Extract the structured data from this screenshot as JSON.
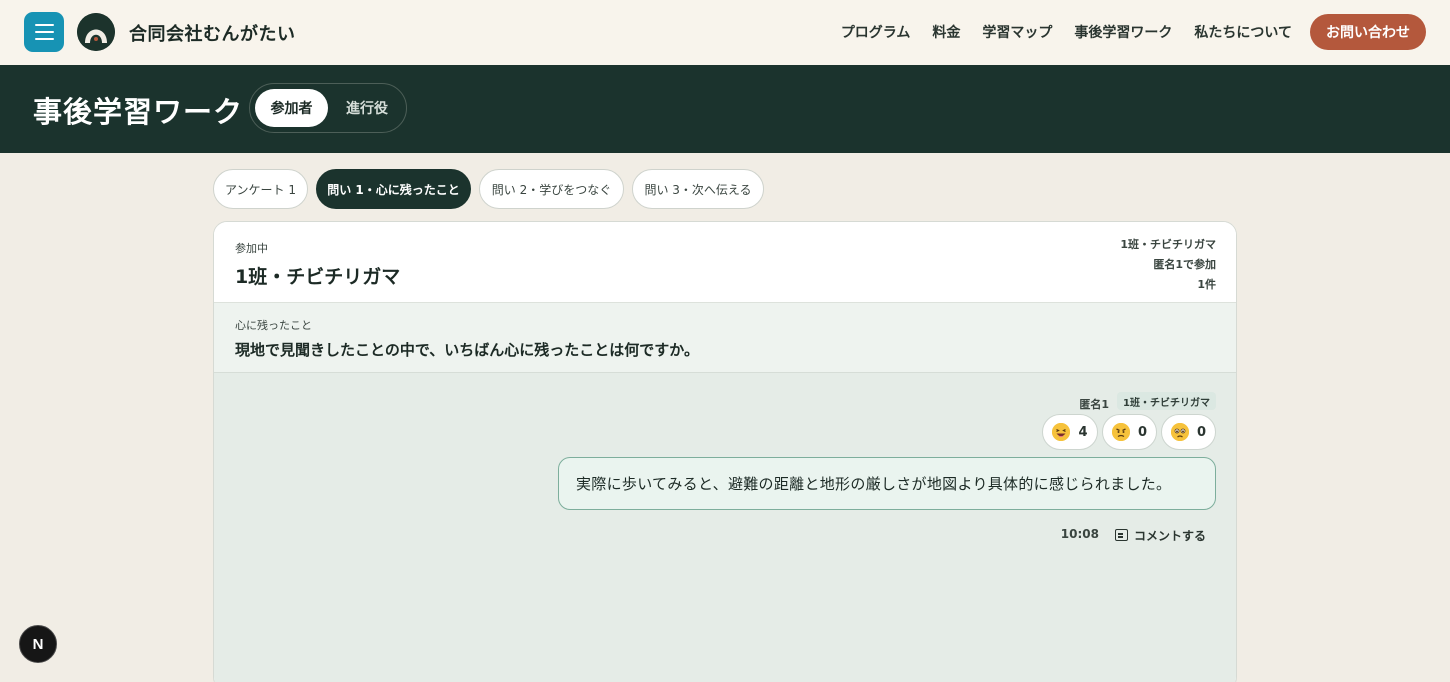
{
  "brand": {
    "name": "合同会社むんがたい"
  },
  "nav": {
    "items": [
      "プログラム",
      "料金",
      "学習マップ",
      "事後学習ワーク",
      "私たちについて"
    ],
    "contact_label": "お問い合わせ"
  },
  "header": {
    "title": "事後学習ワーク",
    "roles": [
      "参加者",
      "進行役"
    ],
    "active_role": "参加者"
  },
  "tabs": [
    {
      "label": "アンケート 1",
      "active": false
    },
    {
      "label": "問い 1・心に残ったこと",
      "active": true
    },
    {
      "label": "問い 2・学びをつなぐ",
      "active": false
    },
    {
      "label": "問い 3・次へ伝える",
      "active": false
    }
  ],
  "card": {
    "status": "参加中",
    "group": "1班・チビチリガマ",
    "meta": [
      "1班・チビチリガマ",
      "匿名1で参加",
      "1件"
    ],
    "prompt_label": "心に残ったこと",
    "prompt_text": "現地で見聞きしたことの中で、いちばん心に残ったことは何ですか。"
  },
  "post": {
    "author": "匿名1",
    "group_tag": "1班・チビチリガマ",
    "reactions": [
      {
        "icon": "laughing-emoji-icon",
        "count": "4"
      },
      {
        "icon": "angry-emoji-icon",
        "count": "0"
      },
      {
        "icon": "sad-emoji-icon",
        "count": "0"
      }
    ],
    "text": "実際に歩いてみると、避難の距離と地形の厳しさが地図より具体的に感じられました。",
    "time": "10:08",
    "comment_label": "コメントする"
  },
  "dev_badge": {
    "label": "N"
  },
  "colors": {
    "accent_blue": "#1793b4",
    "dark_green": "#1b332d",
    "contact_orange": "#b4583c",
    "bubble_border": "#7dae9c"
  }
}
